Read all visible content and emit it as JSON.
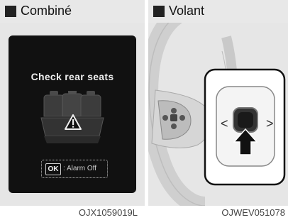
{
  "left": {
    "header": "Combiné",
    "display_title": "Check rear seats",
    "ok_key": "OK",
    "alarm_text": ": Alarm Off",
    "code": "OJX1059019L"
  },
  "right": {
    "header": "Volant",
    "arrow_left": "<",
    "arrow_right": ">",
    "code": "OJWEV051078"
  },
  "colors": {
    "header_bg": "#e8e8e8",
    "display_bg": "#111111",
    "panel_bg": "#e6e6e6"
  },
  "icons": [
    "rear-seat-icon",
    "warning-triangle-icon",
    "steering-wheel",
    "ok-button",
    "press-arrow-icon"
  ]
}
